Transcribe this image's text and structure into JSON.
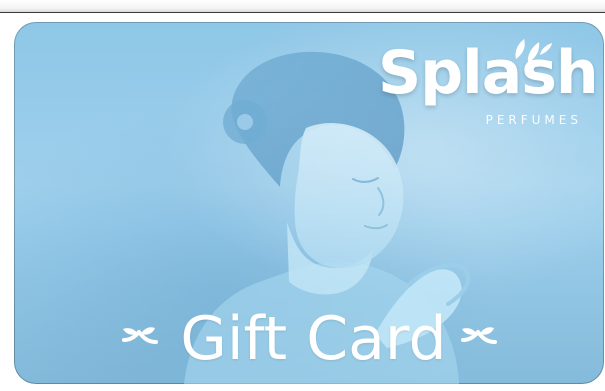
{
  "card": {
    "brand": "Splash",
    "brand_sub": "PERFUMES",
    "title": "Gift Card"
  },
  "colors": {
    "card_background": "#9dcfec",
    "text": "#ffffff"
  },
  "icons": {
    "logo_splash": "splash-drop-icon",
    "flourish_left": "leaf-flourish-icon",
    "flourish_right": "leaf-flourish-icon"
  }
}
